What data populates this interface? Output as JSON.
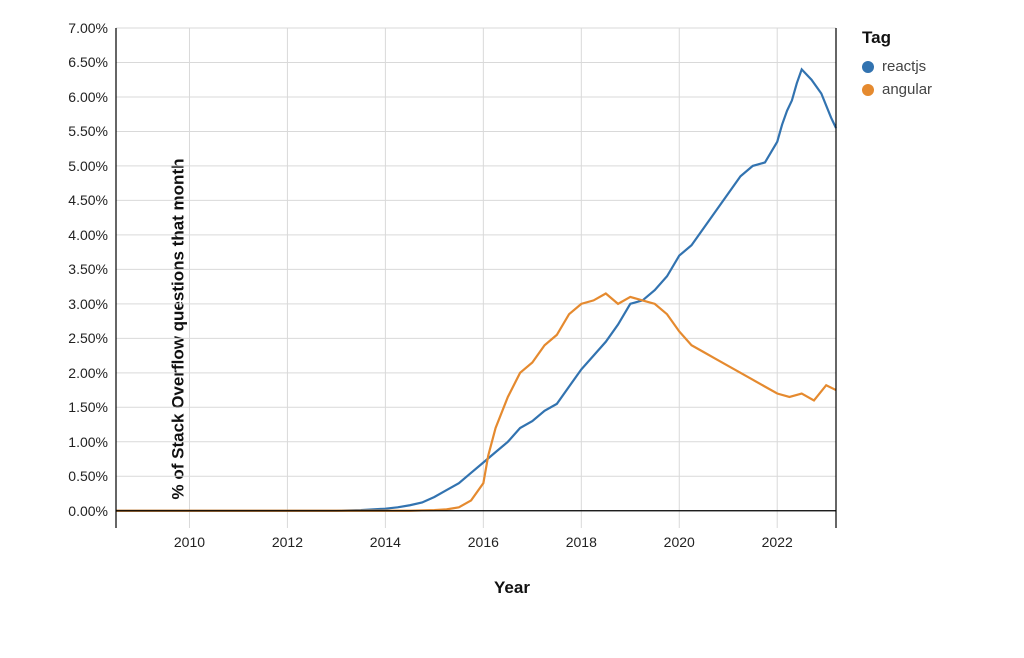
{
  "chart_data": {
    "type": "line",
    "xlabel": "Year",
    "ylabel": "% of Stack Overflow questions that month",
    "xlim": [
      2008.5,
      2023.2
    ],
    "ylim": [
      -0.25,
      7.0
    ],
    "xticks": [
      2010,
      2012,
      2014,
      2016,
      2018,
      2020,
      2022
    ],
    "yticks": [
      0.0,
      0.5,
      1.0,
      1.5,
      2.0,
      2.5,
      3.0,
      3.5,
      4.0,
      4.5,
      5.0,
      5.5,
      6.0,
      6.5,
      7.0
    ],
    "ytick_labels": [
      "0.00%",
      "0.50%",
      "1.00%",
      "1.50%",
      "2.00%",
      "2.50%",
      "3.00%",
      "3.50%",
      "4.00%",
      "4.50%",
      "5.00%",
      "5.50%",
      "6.00%",
      "6.50%",
      "7.00%"
    ],
    "legend_title": "Tag",
    "series": [
      {
        "name": "reactjs",
        "color": "#3273b0",
        "x": [
          2008.5,
          2009.0,
          2009.5,
          2010.0,
          2010.5,
          2011.0,
          2011.5,
          2012.0,
          2012.5,
          2013.0,
          2013.5,
          2014.0,
          2014.25,
          2014.5,
          2014.75,
          2015.0,
          2015.25,
          2015.5,
          2015.75,
          2016.0,
          2016.25,
          2016.5,
          2016.75,
          2017.0,
          2017.25,
          2017.5,
          2017.75,
          2018.0,
          2018.25,
          2018.5,
          2018.75,
          2019.0,
          2019.25,
          2019.5,
          2019.75,
          2020.0,
          2020.25,
          2020.5,
          2020.75,
          2021.0,
          2021.25,
          2021.5,
          2021.75,
          2022.0,
          2022.1,
          2022.2,
          2022.3,
          2022.4,
          2022.5,
          2022.7,
          2022.9,
          2023.1,
          2023.2
        ],
        "y": [
          0.0,
          0.0,
          0.0,
          0.0,
          0.0,
          0.0,
          0.0,
          0.0,
          0.0,
          0.0,
          0.01,
          0.03,
          0.05,
          0.08,
          0.12,
          0.2,
          0.3,
          0.4,
          0.55,
          0.7,
          0.85,
          1.0,
          1.2,
          1.3,
          1.45,
          1.55,
          1.8,
          2.05,
          2.25,
          2.45,
          2.7,
          3.0,
          3.05,
          3.2,
          3.4,
          3.7,
          3.85,
          4.1,
          4.35,
          4.6,
          4.85,
          5.0,
          5.05,
          5.35,
          5.6,
          5.8,
          5.95,
          6.2,
          6.4,
          6.25,
          6.05,
          5.7,
          5.55
        ]
      },
      {
        "name": "angular",
        "color": "#e58a2f",
        "x": [
          2008.5,
          2009.0,
          2009.5,
          2010.0,
          2010.5,
          2011.0,
          2011.5,
          2012.0,
          2012.5,
          2013.0,
          2013.5,
          2014.0,
          2014.5,
          2015.0,
          2015.25,
          2015.5,
          2015.75,
          2016.0,
          2016.1,
          2016.25,
          2016.5,
          2016.75,
          2017.0,
          2017.25,
          2017.5,
          2017.75,
          2018.0,
          2018.25,
          2018.5,
          2018.75,
          2019.0,
          2019.25,
          2019.5,
          2019.75,
          2020.0,
          2020.25,
          2020.5,
          2020.75,
          2021.0,
          2021.25,
          2021.5,
          2021.75,
          2022.0,
          2022.25,
          2022.5,
          2022.75,
          2023.0,
          2023.2
        ],
        "y": [
          0.0,
          0.0,
          0.0,
          0.0,
          0.0,
          0.0,
          0.0,
          0.0,
          0.0,
          0.0,
          0.0,
          0.0,
          0.0,
          0.01,
          0.02,
          0.05,
          0.15,
          0.4,
          0.8,
          1.2,
          1.65,
          2.0,
          2.15,
          2.4,
          2.55,
          2.85,
          3.0,
          3.05,
          3.15,
          3.0,
          3.1,
          3.05,
          3.0,
          2.85,
          2.6,
          2.4,
          2.3,
          2.2,
          2.1,
          2.0,
          1.9,
          1.8,
          1.7,
          1.65,
          1.7,
          1.6,
          1.82,
          1.75
        ]
      }
    ]
  }
}
